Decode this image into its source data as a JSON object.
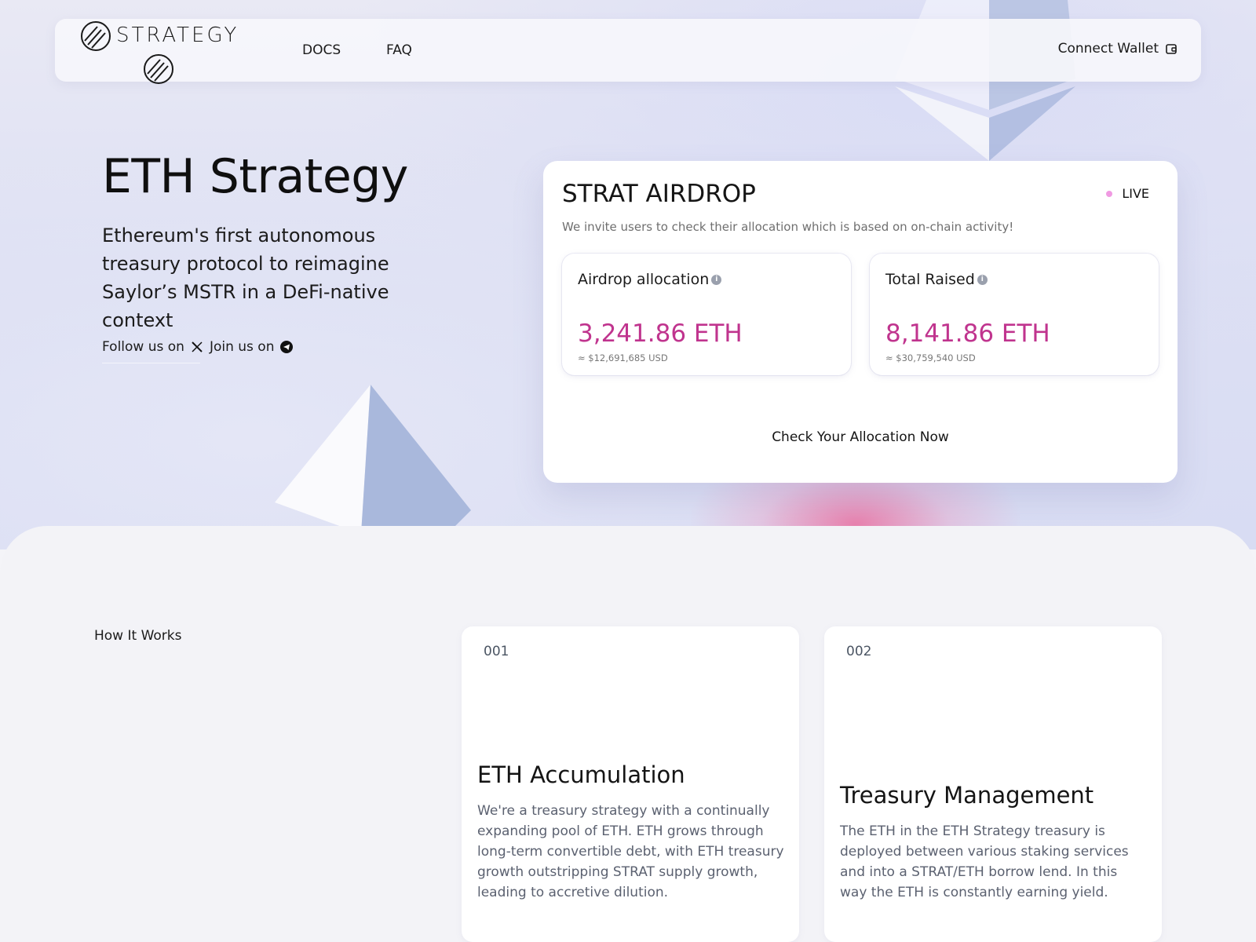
{
  "nav": {
    "brand": "STRATEGY",
    "links": [
      "DOCS",
      "FAQ"
    ],
    "connect_label": "Connect Wallet",
    "connect_icon": "wallet-icon"
  },
  "hero": {
    "title": "ETH Strategy",
    "subtitle": "Ethereum's first autonomous treasury protocol to reimagine Saylor’s MSTR in a DeFi-native context",
    "follow_label": "Follow us on",
    "follow_icon": "x-icon",
    "join_label": "Join us on",
    "join_icon": "telegram-icon"
  },
  "airdrop": {
    "title": "STRAT AIRDROP",
    "status": "LIVE",
    "status_color": "#f09ae2",
    "description": "We invite users to check their allocation which is based on on-chain activity!",
    "stats": [
      {
        "label": "Airdrop allocation",
        "value": "3,241.86 ETH",
        "usd": "≈ $12,691,685 USD"
      },
      {
        "label": "Total Raised",
        "value": "8,141.86 ETH",
        "usd": "≈ $30,759,540 USD"
      }
    ],
    "cta": "Check Your Allocation Now",
    "accent": "#c0348e"
  },
  "how_it_works": {
    "heading": "How It Works",
    "steps": [
      {
        "num": "001",
        "title": "ETH Accumulation",
        "body": "We're a treasury strategy with a continually expanding pool of ETH. ETH grows through long-term convertible debt, with ETH treasury growth outstripping STRAT supply growth, leading to accretive dilution."
      },
      {
        "num": "002",
        "title": "Treasury Management",
        "body": "The ETH in the ETH Strategy treasury is deployed between various staking services and into a STRAT/ETH borrow lend. In this way the ETH is constantly earning yield."
      }
    ]
  }
}
